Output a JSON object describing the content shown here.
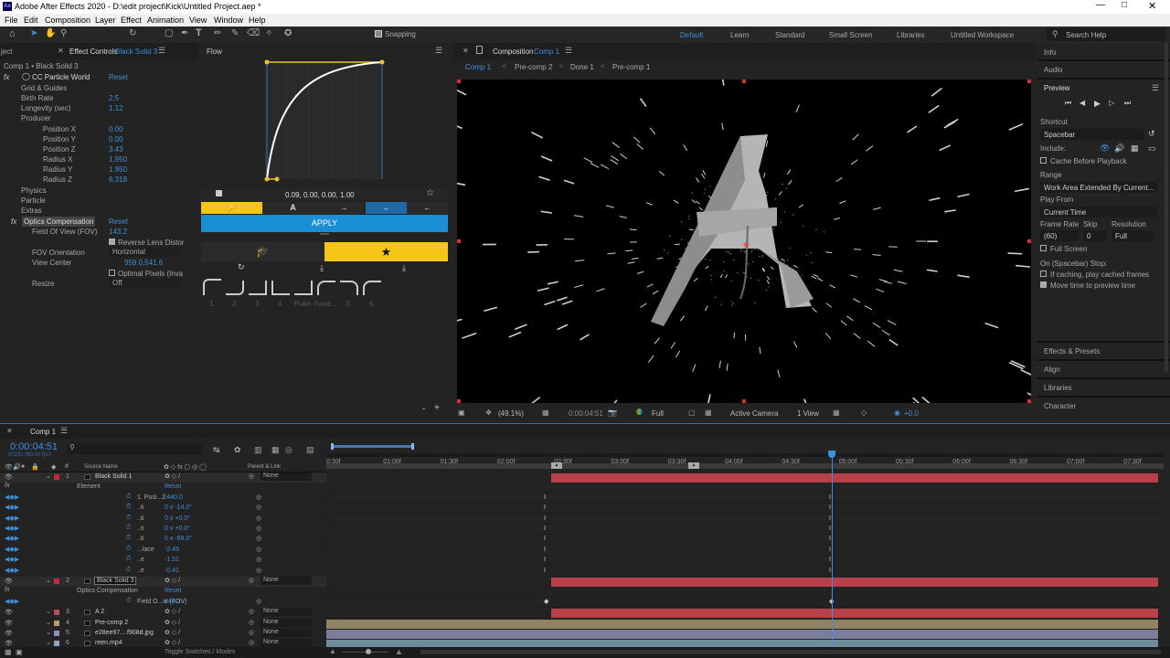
{
  "app": {
    "title": "Adobe After Effects 2020 - D:\\edit project\\Kick\\Untitled Project.aep *",
    "logo": "Ae"
  },
  "menu": [
    "File",
    "Edit",
    "Composition",
    "Layer",
    "Effect",
    "Animation",
    "View",
    "Window",
    "Help"
  ],
  "toolbar": {
    "snapping": "Snapping",
    "workspaces": [
      "Default",
      "Learn",
      "Standard",
      "Small Screen",
      "Libraries",
      "Untitled Workspace"
    ],
    "active_workspace": "Default",
    "search_placeholder": "Search Help"
  },
  "effect_controls": {
    "tab_left": "ject",
    "tab": "Effect Controls",
    "tab_layer": "Black Solid 3",
    "breadcrumb": "Comp 1 • Black Solid 3",
    "effects": [
      {
        "name": "CC Particle World",
        "reset": "Reset"
      },
      {
        "name": "Optics Compensation",
        "reset": "Reset"
      }
    ],
    "props": [
      {
        "label": "Grid & Guides",
        "value": ""
      },
      {
        "label": "Birth Rate",
        "value": "2.5"
      },
      {
        "label": "Longevity (sec)",
        "value": "1.12"
      },
      {
        "label": "Producer",
        "value": ""
      },
      {
        "label": "Position X",
        "value": "0.00"
      },
      {
        "label": "Position Y",
        "value": "0.00"
      },
      {
        "label": "Position Z",
        "value": "3.43"
      },
      {
        "label": "Radius X",
        "value": "1.950"
      },
      {
        "label": "Radius Y",
        "value": "1.950"
      },
      {
        "label": "Radius Z",
        "value": "6.318"
      },
      {
        "label": "Physics",
        "value": ""
      },
      {
        "label": "Particle",
        "value": ""
      },
      {
        "label": "Extras",
        "value": ""
      }
    ],
    "optics": [
      {
        "label": "Field Of View (FOV)",
        "value": "143.2"
      },
      {
        "label": "",
        "value": "Reverse Lens Distor"
      },
      {
        "label": "FOV Orientation",
        "value": "Horizontal"
      },
      {
        "label": "View Center",
        "value": "959.0,541.6"
      },
      {
        "label": "",
        "value": "Optimal Pixels (Inva"
      },
      {
        "label": "Resize",
        "value": "Off"
      }
    ]
  },
  "flow": {
    "title": "Flow",
    "values": "0.09, 0.00, 0.00, 1.00",
    "apply": "APPLY",
    "presets": [
      "1",
      "2",
      "3",
      "4",
      "Puke",
      "Fave...",
      "5",
      "6"
    ]
  },
  "composition": {
    "title": "Composition",
    "comp": "Comp 1",
    "tabs": [
      "Comp 1",
      "Pre-comp 2",
      "Done 1",
      "Pre-comp 1"
    ],
    "letter": "A",
    "footer": {
      "zoom": "(49.1%)",
      "time": "0:00:04:51",
      "quality": "Full",
      "camera": "Active Camera",
      "view": "1 View",
      "exposure": "+0.0"
    }
  },
  "right": {
    "info": "Info",
    "audio": "Audio",
    "preview": "Preview",
    "shortcut_label": "Shortcut",
    "shortcut": "Spacebar",
    "include": "Include:",
    "cache": "Cache Before Playback",
    "range_label": "Range",
    "range": "Work Area Extended By Current...",
    "play_from_label": "Play From",
    "play_from": "Current Time",
    "frame_rate_label": "Frame Rate",
    "skip_label": "Skip",
    "resolution_label": "Resolution",
    "frame_rate": "(60)",
    "skip": "0",
    "resolution": "Full",
    "full_screen": "Full Screen",
    "stop_label": "On (Spacebar) Stop:",
    "stop1": "If caching, play cached frames",
    "stop2": "Move time to preview time",
    "panels": [
      "Effects & Presets",
      "Align",
      "Libraries",
      "Character"
    ]
  },
  "timeline": {
    "tab": "Comp 1",
    "time": "0:00:04:51",
    "frames": "00291 (60.00 fps)",
    "col_source": "Source Name",
    "col_parent": "Parent & Link",
    "toggle": "Toggle Switches / Modes",
    "ruler": [
      "0:30f",
      "01:00f",
      "01:30f",
      "02:00f",
      "02:30f",
      "03:00f",
      "03:30f",
      "04:00f",
      "04:30f",
      "05:00f",
      "05:30f",
      "06:00f",
      "06:30f",
      "07:00f",
      "07:30f"
    ],
    "rows": [
      {
        "n": "1",
        "name": "Black Solid 1",
        "parent": "None",
        "kind": "layer"
      },
      {
        "n": "",
        "name": "Element",
        "value": "Reset",
        "kind": "group"
      },
      {
        "n": "",
        "name": "1. Posi...Z",
        "value": "-440.0",
        "kind": "prop"
      },
      {
        "n": "",
        "name": "..ti",
        "value": "0 x -14.0°",
        "kind": "prop"
      },
      {
        "n": "",
        "name": "..ti",
        "value": "0 x +0.0°",
        "kind": "prop"
      },
      {
        "n": "",
        "name": "..ti",
        "value": "0 x +0.0°",
        "kind": "prop"
      },
      {
        "n": "",
        "name": "..ti",
        "value": "0 x -69.0°",
        "kind": "prop"
      },
      {
        "n": "",
        "name": "...lace",
        "value": "-2.49",
        "kind": "prop"
      },
      {
        "n": "",
        "name": "..e",
        "value": "-1.51",
        "kind": "prop"
      },
      {
        "n": "",
        "name": "..e",
        "value": "-0.41",
        "kind": "prop"
      },
      {
        "n": "2",
        "name": "Black Solid 3",
        "parent": "None",
        "kind": "layer"
      },
      {
        "n": "",
        "name": "Optics Compensation",
        "value": "Reset",
        "kind": "group"
      },
      {
        "n": "",
        "name": "Field O...w (FOV)",
        "value": "143.2",
        "kind": "prop"
      },
      {
        "n": "3",
        "name": "A 2",
        "parent": "None",
        "kind": "layer"
      },
      {
        "n": "4",
        "name": "Pre-comp 2",
        "parent": "None",
        "kind": "layer"
      },
      {
        "n": "5",
        "name": "e28ee97....f908d.jpg",
        "parent": "None",
        "kind": "layer"
      },
      {
        "n": "6",
        "name": "reen.mp4",
        "parent": "None",
        "kind": "layer"
      }
    ]
  },
  "colors": {
    "accent": "#2d8ceb",
    "yellow": "#f5c518",
    "apply_blue": "#1a8fd6",
    "layer_red": "#b8404a",
    "playhead": "#3c8ee8"
  }
}
